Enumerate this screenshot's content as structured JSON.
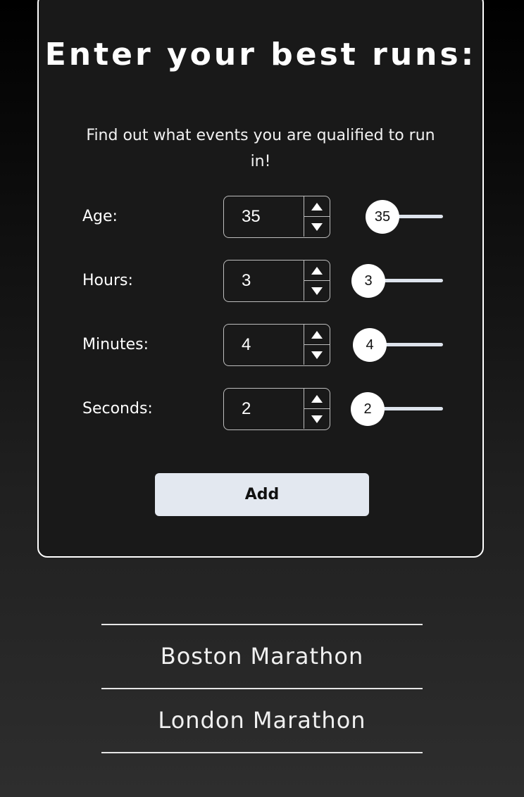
{
  "form": {
    "title": "Enter your best runs:",
    "subtitle": "Find out what events you are qualified to run in!",
    "fields": [
      {
        "label": "Age:",
        "value": "35",
        "slider_label": "35"
      },
      {
        "label": "Hours:",
        "value": "3",
        "slider_label": "3"
      },
      {
        "label": "Minutes:",
        "value": "4",
        "slider_label": "4"
      },
      {
        "label": "Seconds:",
        "value": "2",
        "slider_label": "2"
      }
    ],
    "add_label": "Add"
  },
  "events": {
    "items": [
      "Boston Marathon",
      "London Marathon"
    ]
  },
  "colors": {
    "card_background": "#191919",
    "button_background": "#e3e8f0",
    "slider_track": "#dde3ec"
  },
  "icons": {
    "spin_up": "triangle-up-icon",
    "spin_down": "triangle-down-icon"
  }
}
